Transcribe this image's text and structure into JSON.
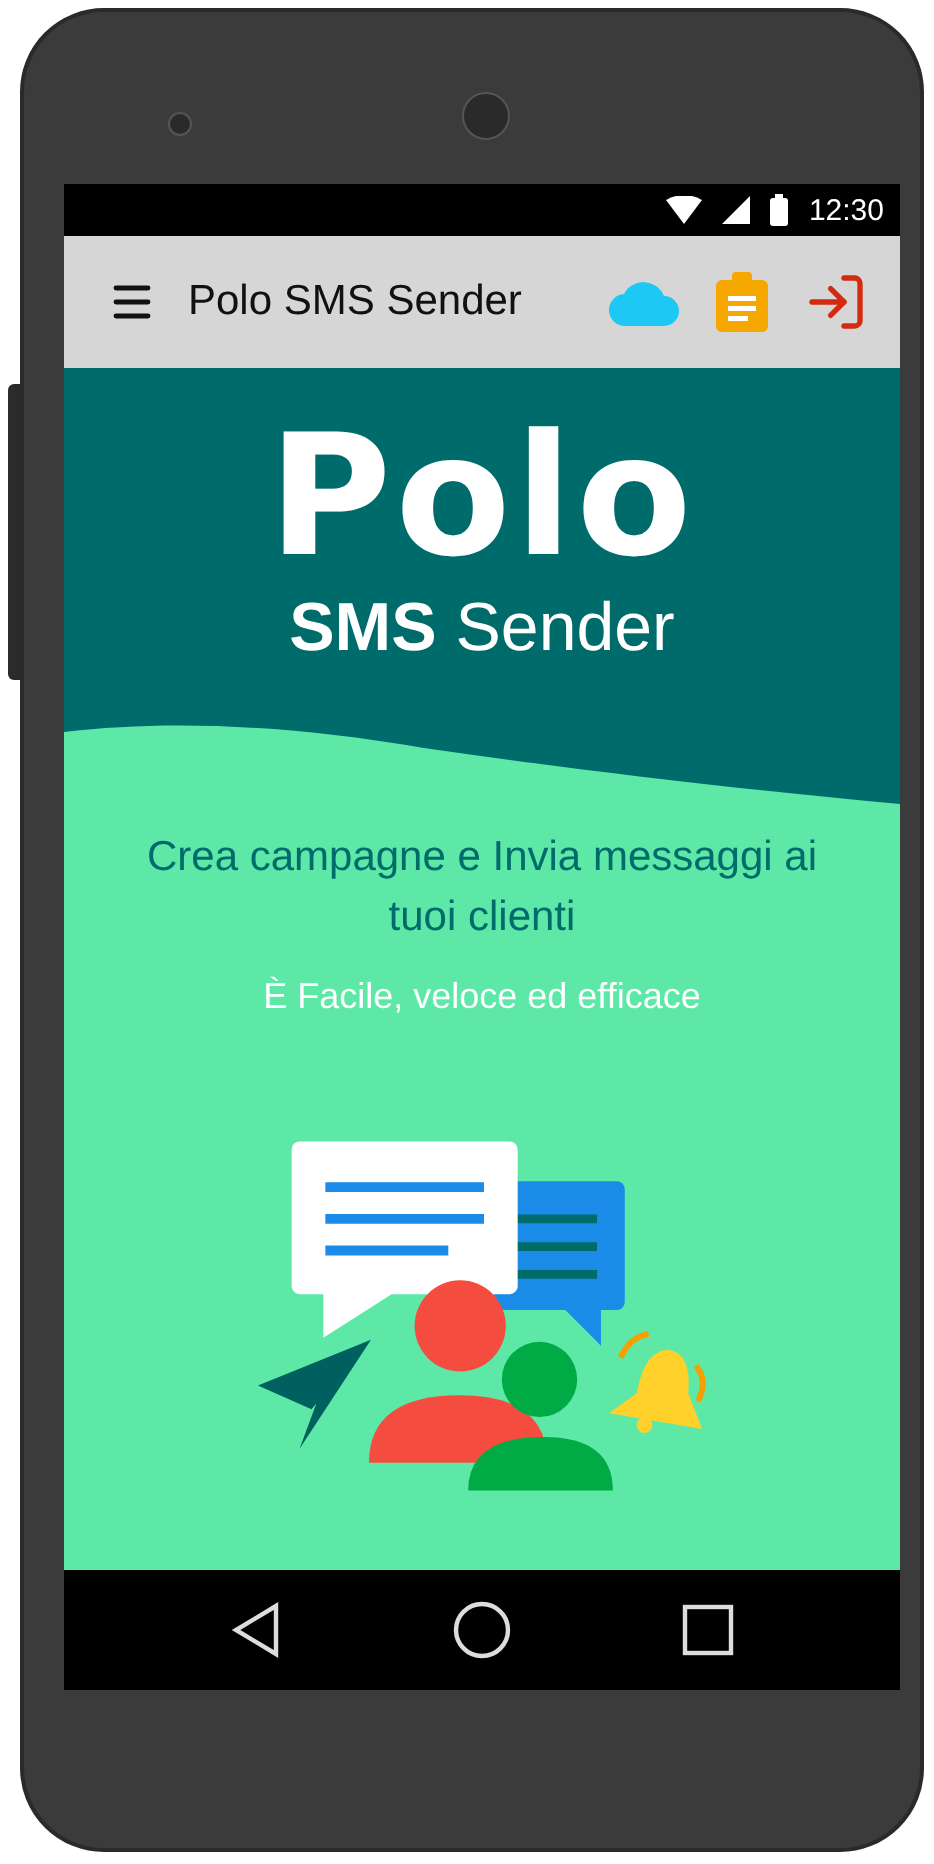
{
  "status_bar": {
    "time": "12:30"
  },
  "app_bar": {
    "title": "Polo SMS Sender"
  },
  "hero": {
    "logo": "Polo",
    "subtitle": "**SMS** Sender"
  },
  "headline": "Crea campagne e Invia messaggi ai tuoi clienti",
  "tagline": "È Facile, veloce ed efficace"
}
